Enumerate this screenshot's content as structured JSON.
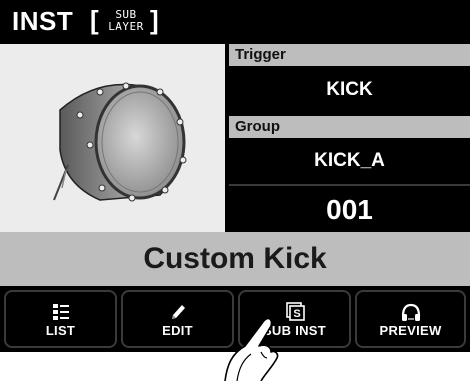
{
  "header": {
    "title": "INST",
    "sub_line1": "SUB",
    "sub_line2": "LAYER",
    "bracket_open": "[",
    "bracket_close": "]"
  },
  "fields": {
    "trigger_label": "Trigger",
    "trigger_value": "KICK",
    "group_label": "Group",
    "group_value": "KICK_A",
    "number": "001"
  },
  "instrument_name": "Custom Kick",
  "buttons": [
    {
      "label": "LIST",
      "icon": "list-icon"
    },
    {
      "label": "EDIT",
      "icon": "pencil-icon"
    },
    {
      "label": "SUB INST",
      "icon": "sub-inst-icon"
    },
    {
      "label": "PREVIEW",
      "icon": "headphones-icon"
    }
  ],
  "colors": {
    "background": "#000000",
    "label_bar": "#bdbdbd",
    "name_bar": "#bdbdbd",
    "text_light": "#ffffff"
  }
}
